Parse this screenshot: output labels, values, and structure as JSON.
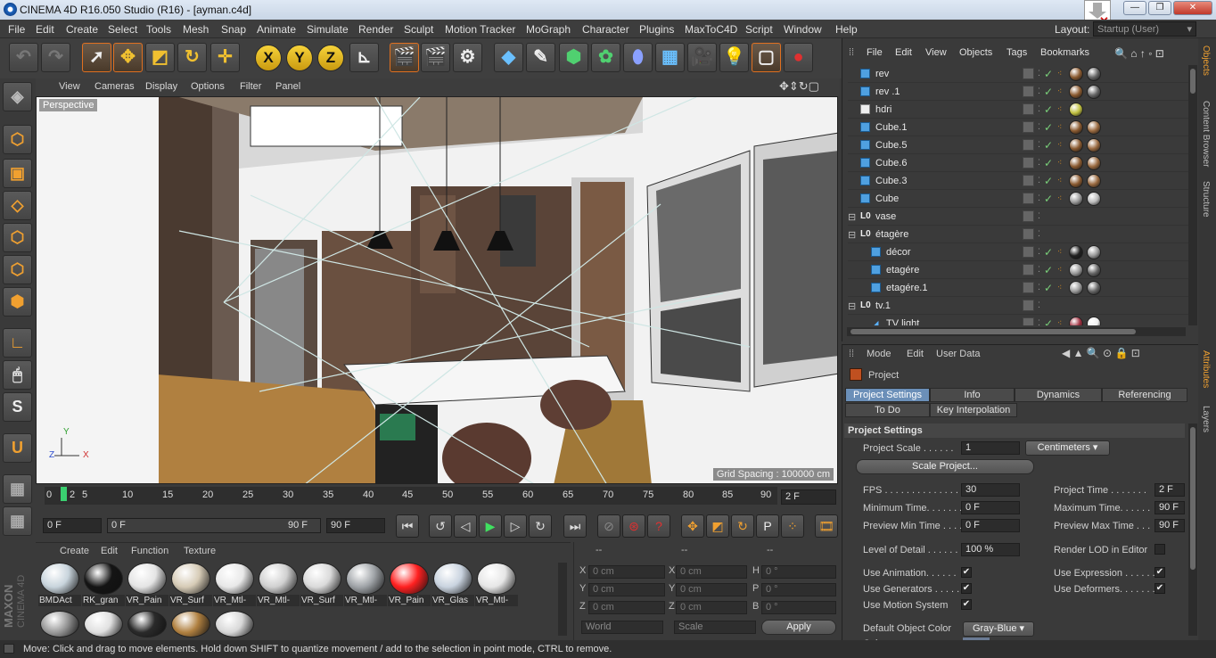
{
  "window": {
    "title": "CINEMA 4D R16.050 Studio (R16) - [ayman.c4d]"
  },
  "menu": [
    "File",
    "Edit",
    "Create",
    "Select",
    "Tools",
    "Mesh",
    "Snap",
    "Animate",
    "Simulate",
    "Render",
    "Sculpt",
    "Motion Tracker",
    "MoGraph",
    "Character",
    "Plugins",
    "MaxToC4D",
    "Script",
    "Window",
    "Help"
  ],
  "layout": {
    "label": "Layout:",
    "value": "Startup (User)"
  },
  "viewport": {
    "menu": [
      "View",
      "Cameras",
      "Display",
      "Options",
      "Filter",
      "Panel"
    ],
    "camera_label": "Perspective",
    "grid_spacing": "Grid Spacing : 100000 cm",
    "axis": {
      "y": "Y",
      "z": "Z",
      "x": "X"
    }
  },
  "timeline": {
    "ticks": [
      "0",
      "2",
      "5",
      "10",
      "15",
      "20",
      "25",
      "30",
      "35",
      "40",
      "45",
      "50",
      "55",
      "60",
      "65",
      "70",
      "75",
      "80",
      "85",
      "90"
    ],
    "current_frame": "2 F"
  },
  "playback": {
    "start": "0 F",
    "range_start": "0 F",
    "range_end": "90 F",
    "end": "90 F"
  },
  "material_manager": {
    "menu": [
      "Create",
      "Edit",
      "Function",
      "Texture"
    ],
    "materials": [
      {
        "name": "BMDAct",
        "color": "#c8d4dc"
      },
      {
        "name": "RK_gran",
        "color": "#141414"
      },
      {
        "name": "VR_Pain",
        "color": "#e4e4e4"
      },
      {
        "name": "VR_Surf",
        "color": "#d6cbb6"
      },
      {
        "name": "VR_Mtl-",
        "color": "#e8e8e8"
      },
      {
        "name": "VR_Mtl-",
        "color": "#d0d0d0"
      },
      {
        "name": "VR_Surf",
        "color": "#dadada"
      },
      {
        "name": "VR_Mtl-",
        "color": "#a0a4a8"
      },
      {
        "name": "VR_Pain",
        "color": "#ff2020"
      },
      {
        "name": "VR_Glas",
        "color": "#c9d3df"
      },
      {
        "name": "VR_Mtl-",
        "color": "#e6e6e6"
      }
    ],
    "row2_colors": [
      "#9a9a9a",
      "#e0e0e0",
      "#2a2a2a",
      "#b08040",
      "#d8d8d8"
    ]
  },
  "maxon": {
    "brand": "MAXON",
    "product": "CINEMA 4D"
  },
  "coordinates": {
    "header": [
      "--",
      "--",
      "--"
    ],
    "rows": [
      {
        "a": "X",
        "v1": "0 cm",
        "b": "X",
        "v2": "0 cm",
        "c": "H",
        "v3": "0 °"
      },
      {
        "a": "Y",
        "v1": "0 cm",
        "b": "Y",
        "v2": "0 cm",
        "c": "P",
        "v3": "0 °"
      },
      {
        "a": "Z",
        "v1": "0 cm",
        "b": "Z",
        "v2": "0 cm",
        "c": "B",
        "v3": "0 °"
      }
    ],
    "world": "World",
    "scale": "Scale",
    "apply": "Apply"
  },
  "object_manager": {
    "menu": [
      "File",
      "Edit",
      "View",
      "Objects",
      "Tags",
      "Bookmarks"
    ],
    "objects": [
      {
        "name": "rev",
        "type": "poly",
        "indent": 0,
        "tags": [
          "#8a5a30",
          "#666"
        ]
      },
      {
        "name": "rev .1",
        "type": "poly",
        "indent": 0,
        "tags": [
          "#8a5a30",
          "#666"
        ]
      },
      {
        "name": "hdri",
        "type": "sky",
        "indent": 0,
        "tags": [
          "#c0c040"
        ]
      },
      {
        "name": "Cube.1",
        "type": "poly",
        "indent": 0,
        "tags": [
          "#8a5a30",
          "#9a6a40"
        ]
      },
      {
        "name": "Cube.5",
        "type": "poly",
        "indent": 0,
        "tags": [
          "#8a5a30",
          "#9a6a40"
        ]
      },
      {
        "name": "Cube.6",
        "type": "poly",
        "indent": 0,
        "tags": [
          "#8a5a30",
          "#9a6a40"
        ]
      },
      {
        "name": "Cube.3",
        "type": "poly",
        "indent": 0,
        "tags": [
          "#8a5a30",
          "#9a6a40"
        ]
      },
      {
        "name": "Cube",
        "type": "poly",
        "indent": 0,
        "tags": [
          "#999",
          "#bbb"
        ]
      },
      {
        "name": "vase",
        "type": "null",
        "indent": 0,
        "tags": []
      },
      {
        "name": "étagère",
        "type": "null",
        "indent": 0,
        "tags": []
      },
      {
        "name": "décor",
        "type": "poly",
        "indent": 1,
        "tags": [
          "#222",
          "#999"
        ]
      },
      {
        "name": "etagére",
        "type": "poly",
        "indent": 1,
        "tags": [
          "#999",
          "#666"
        ]
      },
      {
        "name": "etagére.1",
        "type": "poly",
        "indent": 1,
        "tags": [
          "#999",
          "#666"
        ]
      },
      {
        "name": "tv.1",
        "type": "null",
        "indent": 0,
        "tags": []
      },
      {
        "name": "TV light",
        "type": "light",
        "indent": 1,
        "tags": [
          "#a03040",
          "#eee"
        ]
      }
    ]
  },
  "attribute_manager": {
    "menu": [
      "Mode",
      "Edit",
      "User Data"
    ],
    "object": "Project",
    "tabs_row1": [
      "Project Settings",
      "Info",
      "Dynamics",
      "Referencing"
    ],
    "tabs_row2": [
      "To Do",
      "Key Interpolation"
    ],
    "section": "Project Settings",
    "project_scale": {
      "label": "Project Scale . . . . . .",
      "value": "1",
      "unit": "Centimeters"
    },
    "scale_button": "Scale Project...",
    "fps": {
      "label": "FPS . . . . . . . . . . . . . .",
      "value": "30"
    },
    "project_time": {
      "label": "Project Time . . . . . . .",
      "value": "2 F"
    },
    "min_time": {
      "label": "Minimum Time. . . . . . .",
      "value": "0 F"
    },
    "max_time": {
      "label": "Maximum Time. . . . . .",
      "value": "90 F"
    },
    "preview_min": {
      "label": "Preview Min Time . . . .",
      "value": "0 F"
    },
    "preview_max": {
      "label": "Preview Max Time . . .",
      "value": "90 F"
    },
    "lod": {
      "label": "Level of Detail . . . . . .",
      "value": "100 %"
    },
    "render_lod": "Render LOD in Editor",
    "use_animation": "Use Animation. . . . . .",
    "use_expression": "Use Expression . . . . . .",
    "use_generators": "Use Generators . . . . .",
    "use_deformers": "Use Deformers. . . . . . .",
    "use_motion": "Use Motion System",
    "default_color": {
      "label": "Default Object Color",
      "value": "Gray-Blue"
    },
    "color_label": "Color"
  },
  "right_tabs": {
    "top": [
      "Objects",
      "Content Browser",
      "Structure"
    ],
    "bottom": [
      "Attributes",
      "Layers"
    ]
  },
  "status": "Move: Click and drag to move elements. Hold down SHIFT to quantize movement / add to the selection in point mode, CTRL to remove."
}
